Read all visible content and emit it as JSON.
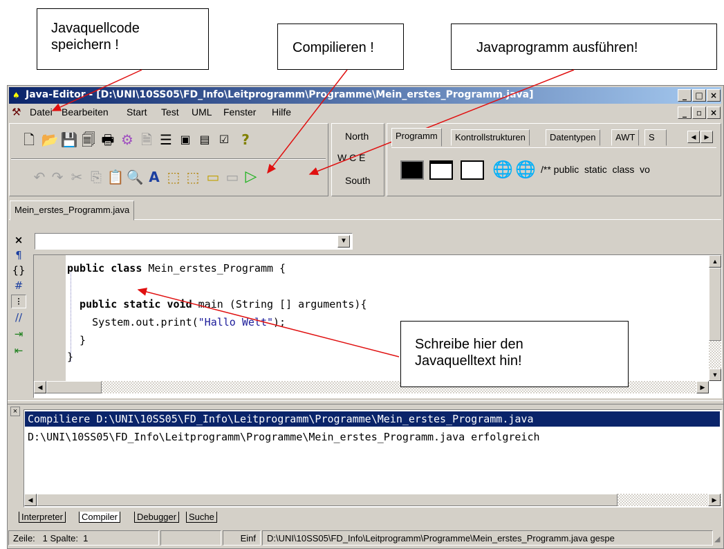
{
  "callouts": {
    "save": "Javaquellcode\nspeichern !",
    "compile": "Compilieren !",
    "run": "Javaprogramm ausführen!",
    "write": "Schreibe hier den\nJavaquelltext hin!"
  },
  "window": {
    "title": "Java-Editor - [D:\\UNI\\10SS05\\FD_Info\\Leitprogramm\\Programme\\Mein_erstes_Programm.java]",
    "min_glyph": "_",
    "max_glyph": "□",
    "close_glyph": "×"
  },
  "menu": {
    "items": [
      "Datei",
      "Bearbeiten",
      "Start",
      "Test",
      "UML",
      "Fenster",
      "Hilfe"
    ],
    "restore_glyph": "▫"
  },
  "layout_panel": {
    "north": "North",
    "wce": "W C E",
    "south": "South"
  },
  "palette": {
    "tabs": [
      "Programm",
      "Kontrollstrukturen",
      "Datentypen",
      "AWT",
      "S"
    ],
    "snippets": "/** public  static  class  vo"
  },
  "file_tab": "Mein_erstes_Programm.java",
  "editor": {
    "lines": [
      {
        "kw": "public class",
        "rest": " Mein_erstes_Programm {"
      },
      {
        "kw": "",
        "rest": ""
      },
      {
        "kw": "  public static void",
        "rest": " main (String [] arguments){"
      },
      {
        "kw": "",
        "rest": "    System.out.print(",
        "str": "\"Hallo Welt\"",
        "tail": ");"
      },
      {
        "kw": "",
        "rest": "  }"
      },
      {
        "kw": "",
        "rest": "}"
      }
    ]
  },
  "console": {
    "line1": "Compiliere D:\\UNI\\10SS05\\FD_Info\\Leitprogramm\\Programme\\Mein_erstes_Programm.java",
    "line2": "D:\\UNI\\10SS05\\FD_Info\\Leitprogramm\\Programme\\Mein_erstes_Programm.java erfolgreich"
  },
  "bottom_tabs": [
    "Interpreter",
    "Compiler",
    "Debugger",
    "Suche"
  ],
  "status": {
    "position": "Zeile:   1 Spalte:  1",
    "mode": "Einf",
    "path": "D:\\UNI\\10SS05\\FD_Info\\Leitprogramm\\Programme\\Mein_erstes_Programm.java gespe"
  },
  "colors": {
    "title_active": "#0a246a",
    "console_highlight": "#0a246a",
    "arrow": "#e01010",
    "run_green": "#19b219"
  },
  "icons": [
    "new-file-icon",
    "open-folder-icon",
    "save-icon",
    "save-all-icon",
    "print-icon",
    "configure-icon",
    "new-class-icon",
    "structure-icon",
    "image-icon",
    "form-icon",
    "checklist-icon",
    "help-icon",
    "undo-icon",
    "redo-icon",
    "cut-icon",
    "copy-icon",
    "paste-icon",
    "find-icon",
    "font-size-icon",
    "compile-file-icon",
    "compile-all-icon",
    "compile-icon",
    "run-disabled-icon",
    "run-icon"
  ]
}
